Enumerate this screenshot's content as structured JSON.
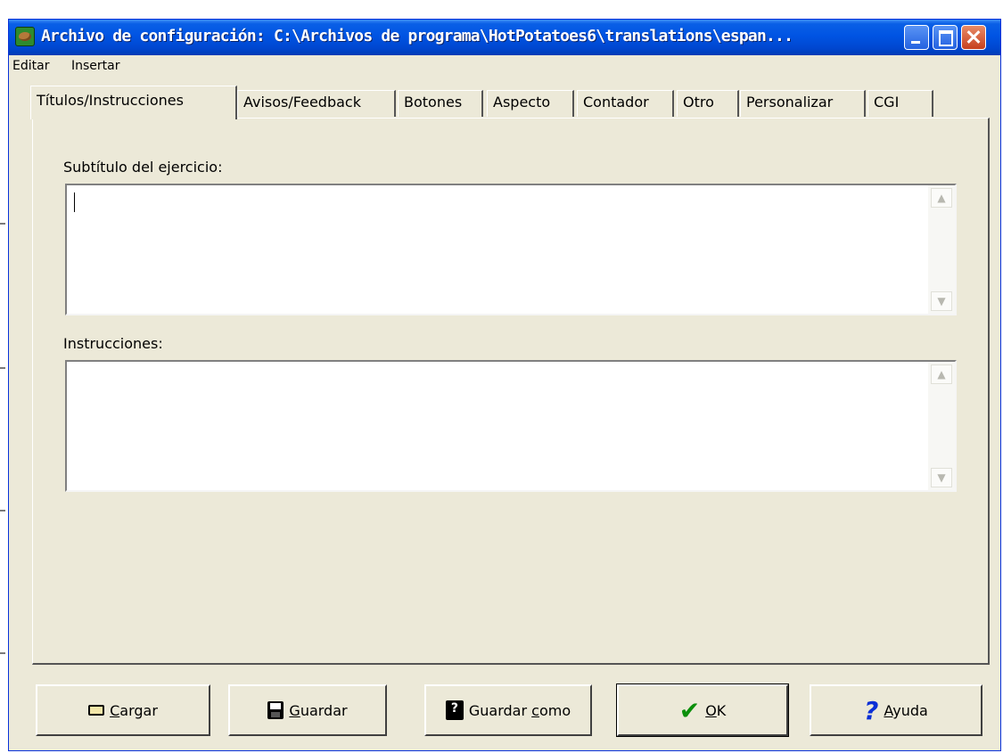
{
  "window": {
    "title": "Archivo de configuración: C:\\Archivos de programa\\HotPotatoes6\\translations\\espan..."
  },
  "menu": {
    "items": [
      "Editar",
      "Insertar"
    ]
  },
  "tabs": [
    {
      "label": "Títulos/Instrucciones",
      "active": true
    },
    {
      "label": "Avisos/Feedback",
      "active": false
    },
    {
      "label": "Botones",
      "active": false
    },
    {
      "label": "Aspecto",
      "active": false
    },
    {
      "label": "Contador",
      "active": false
    },
    {
      "label": "Otro",
      "active": false
    },
    {
      "label": "Personalizar",
      "active": false
    },
    {
      "label": "CGI",
      "active": false
    }
  ],
  "fields": {
    "subtitle_label": "Subtítulo del ejercicio:",
    "subtitle_value": "",
    "instructions_label": "Instrucciones:",
    "instructions_value": ""
  },
  "buttons": {
    "load_label": "argar",
    "load_mnemonic": "C",
    "save_label": "uardar",
    "save_mnemonic": "G",
    "save_as_label_prefix": "Guardar ",
    "save_as_mnemonic": "c",
    "save_as_label_suffix": "omo",
    "ok_mnemonic": "O",
    "ok_label": "K",
    "help_mnemonic": "A",
    "help_label": "yuda"
  },
  "icons": {
    "app": "hot-potatoes-icon",
    "minimize": "minimize-icon",
    "maximize": "maximize-icon",
    "close": "close-icon",
    "load": "folder-open-icon",
    "save": "floppy-disk-icon",
    "save_as": "floppy-disk-question-icon",
    "ok": "checkmark-icon",
    "help": "question-mark-icon"
  }
}
